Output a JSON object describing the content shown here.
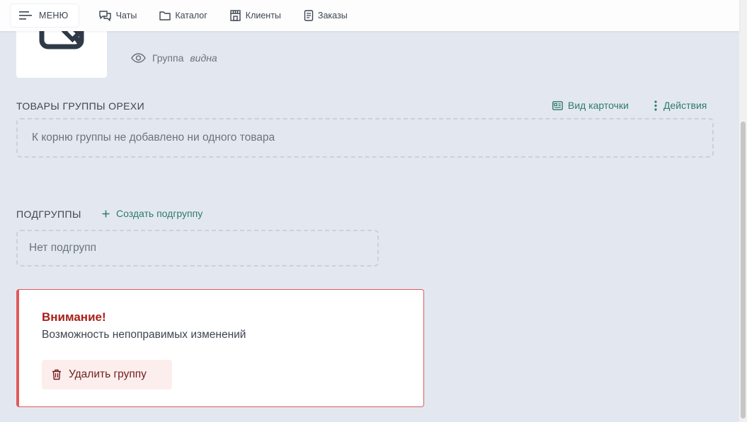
{
  "nav": {
    "menu_label": "МЕНЮ",
    "items": [
      {
        "label": "Чаты",
        "icon": "chat-icon"
      },
      {
        "label": "Каталог",
        "icon": "folder-icon"
      },
      {
        "label": "Клиенты",
        "icon": "store-icon"
      },
      {
        "label": "Заказы",
        "icon": "document-icon"
      }
    ]
  },
  "group": {
    "visibility_label": "Группа",
    "visibility_value": "видна"
  },
  "products": {
    "title": "ТОВАРЫ ГРУППЫ ОРЕХИ",
    "card_view_label": "Вид карточки",
    "actions_label": "Действия",
    "empty_text": "К корню группы не добавлено ни одного товара"
  },
  "subgroups": {
    "title": "ПОДГРУППЫ",
    "create_label": "Создать подгруппу",
    "empty_text": "Нет подгрупп"
  },
  "danger": {
    "title": "Внимание!",
    "text": "Возможность непоправимых изменений",
    "delete_label": "Удалить группу"
  },
  "colors": {
    "background": "#e3e8f0",
    "accent": "#2f7a6b",
    "danger": "#e05a5a",
    "danger_title": "#a8201a"
  }
}
